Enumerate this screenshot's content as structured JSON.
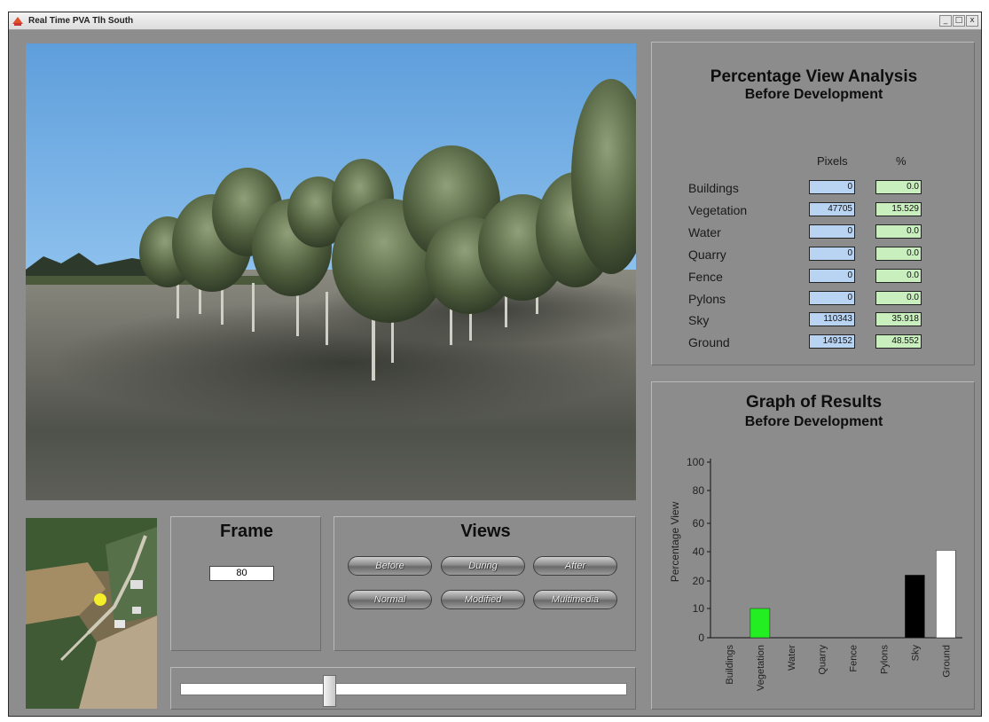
{
  "window": {
    "title": "Real Time PVA Tlh South",
    "buttons": {
      "minimize": "_",
      "restore": "□",
      "close": "x"
    }
  },
  "frame": {
    "title": "Frame",
    "value": "80"
  },
  "views": {
    "title": "Views",
    "buttons": [
      "Before",
      "During",
      "After",
      "Normal",
      "Modified",
      "Multimedia"
    ]
  },
  "slider": {
    "fraction": 0.33
  },
  "pva": {
    "title": "Percentage View Analysis",
    "subtitle": "Before Development",
    "col_pixels": "Pixels",
    "col_percent": "%",
    "rows": [
      {
        "label": "Buildings",
        "pixels": "0",
        "percent": "0.0"
      },
      {
        "label": "Vegetation",
        "pixels": "47705",
        "percent": "15.529"
      },
      {
        "label": "Water",
        "pixels": "0",
        "percent": "0.0"
      },
      {
        "label": "Quarry",
        "pixels": "0",
        "percent": "0.0"
      },
      {
        "label": "Fence",
        "pixels": "0",
        "percent": "0.0"
      },
      {
        "label": "Pylons",
        "pixels": "0",
        "percent": "0.0"
      },
      {
        "label": "Sky",
        "pixels": "110343",
        "percent": "35.918"
      },
      {
        "label": "Ground",
        "pixels": "149152",
        "percent": "48.552"
      }
    ]
  },
  "graph": {
    "title": "Graph of Results",
    "subtitle": "Before Development"
  },
  "chart_data": {
    "type": "bar",
    "title": "Graph of Results",
    "subtitle": "Before Development",
    "xlabel": "",
    "ylabel": "Percentage View",
    "categories": [
      "Buildings",
      "Vegetation",
      "Water",
      "Quarry",
      "Fence",
      "Pylons",
      "Sky",
      "Ground"
    ],
    "values": [
      0,
      10,
      0,
      0,
      0,
      0,
      24,
      41
    ],
    "colors": [
      "#000000",
      "#22ee22",
      "#000000",
      "#000000",
      "#000000",
      "#000000",
      "#000000",
      "#ffffff"
    ],
    "ylim": [
      0,
      100
    ],
    "yticks": [
      "0",
      "10",
      "20",
      "40",
      "60",
      "80",
      "100"
    ],
    "ytick_values": [
      0,
      10,
      20,
      40,
      60,
      80,
      100
    ],
    "tick_spacing": "irregular",
    "grid": false,
    "legend": "none"
  }
}
